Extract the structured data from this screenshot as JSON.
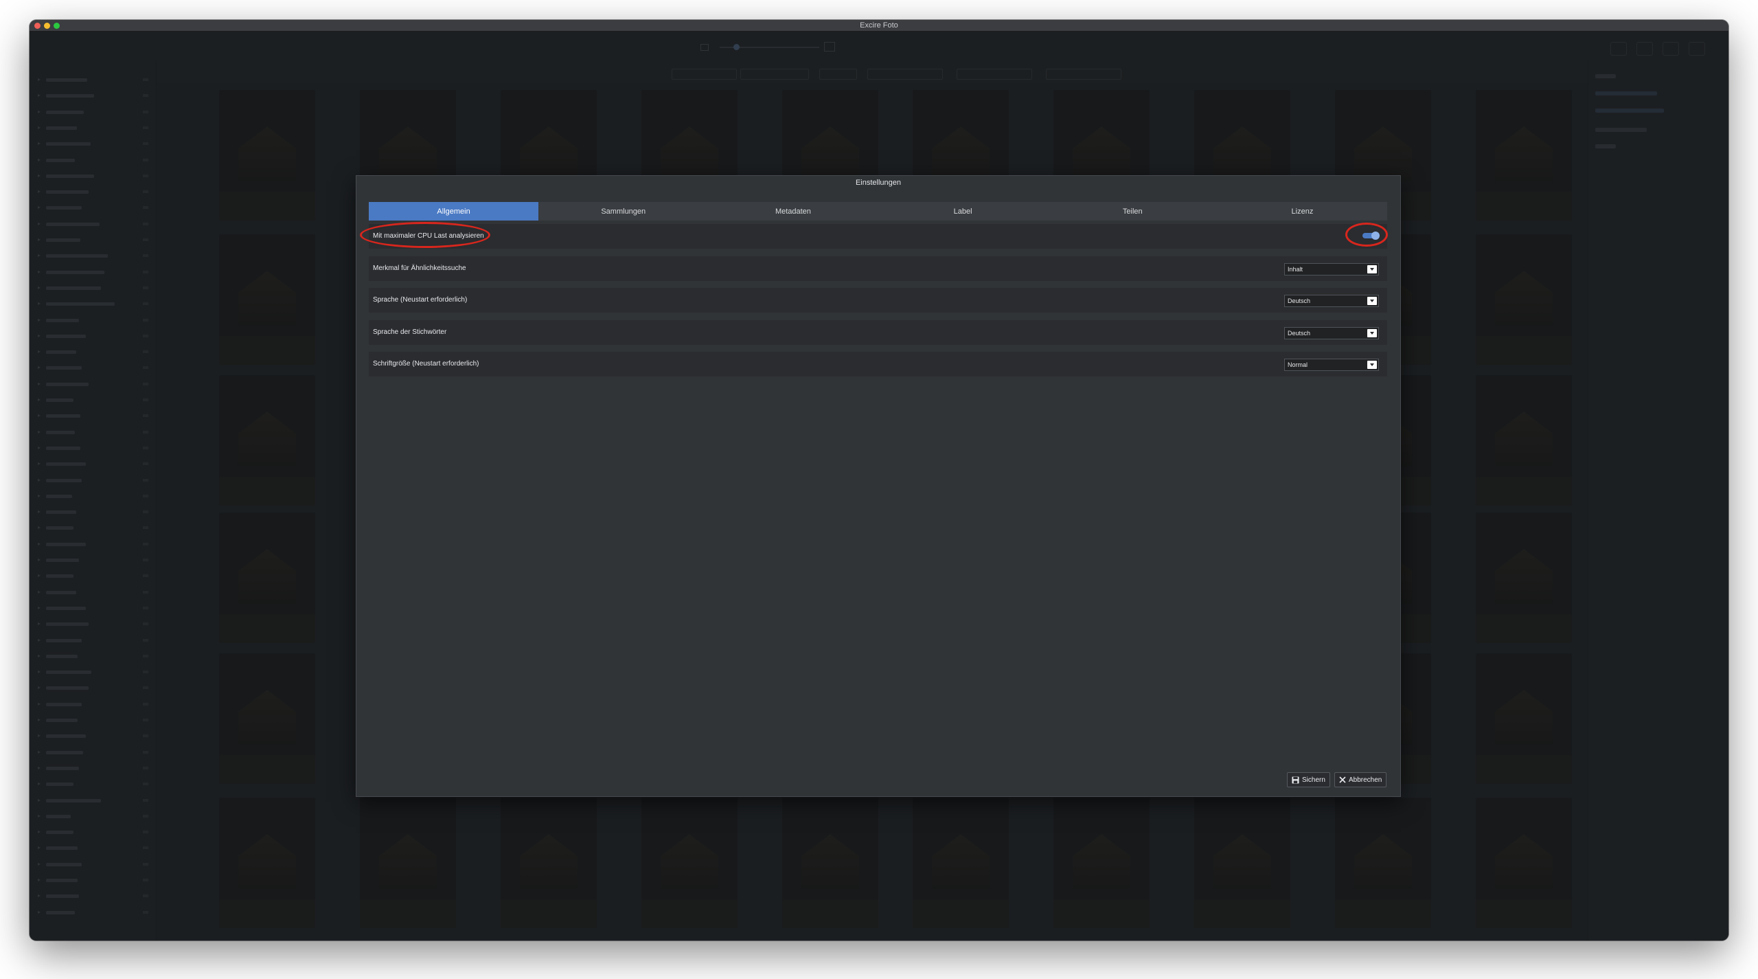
{
  "window": {
    "title": "Excire Foto"
  },
  "dialog": {
    "title": "Einstellungen",
    "tabs": [
      {
        "label": "Allgemein",
        "active": true
      },
      {
        "label": "Sammlungen",
        "active": false
      },
      {
        "label": "Metadaten",
        "active": false
      },
      {
        "label": "Label",
        "active": false
      },
      {
        "label": "Teilen",
        "active": false
      },
      {
        "label": "Lizenz",
        "active": false
      }
    ],
    "settings": {
      "cpu": {
        "label": "Mit maximaler CPU Last analysieren",
        "enabled": true
      },
      "similarity": {
        "label": "Merkmal für Ähnlichkeitssuche",
        "value": "Inhalt"
      },
      "language": {
        "label": "Sprache (Neustart erforderlich)",
        "value": "Deutsch"
      },
      "keyword_language": {
        "label": "Sprache der Stichwörter",
        "value": "Deutsch"
      },
      "font_size": {
        "label": "Schriftgröße (Neustart erforderlich)",
        "value": "Normal"
      }
    },
    "buttons": {
      "save": "Sichern",
      "cancel": "Abbrechen"
    }
  },
  "colors": {
    "accent": "#4b7ac4",
    "annotation": "#d8261d",
    "dialog_bg": "#313437"
  },
  "icons": [
    "save-icon",
    "close-icon",
    "chevron-down-icon"
  ]
}
